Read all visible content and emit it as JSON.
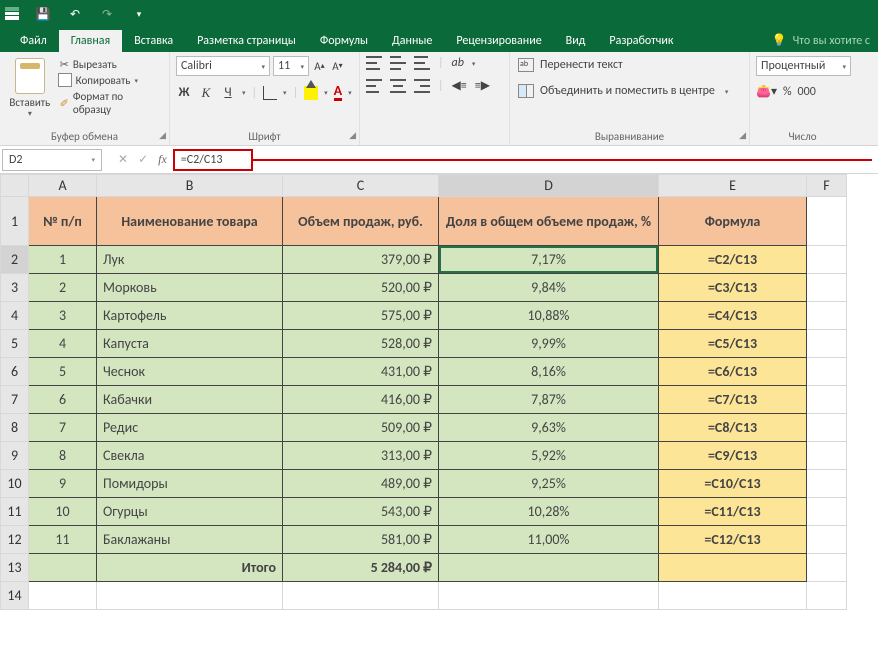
{
  "qat": {
    "save": "💾",
    "undo": "↶",
    "redo": "↷"
  },
  "menu": {
    "file": "Файл",
    "home": "Главная",
    "insert": "Вставка",
    "layout": "Разметка страницы",
    "formulas": "Формулы",
    "data": "Данные",
    "review": "Рецензирование",
    "view": "Вид",
    "developer": "Разработчик",
    "tell": "Что вы хотите с"
  },
  "ribbon": {
    "paste": "Вставить",
    "cut": "Вырезать",
    "copy": "Копировать",
    "painter": "Формат по образцу",
    "clipboard": "Буфер обмена",
    "font_name": "Calibri",
    "font_size": "11",
    "font_group": "Шрифт",
    "wrap": "Перенести текст",
    "merge": "Объединить и поместить в центре",
    "alignment": "Выравнивание",
    "number_format": "Процентный",
    "perc": "%",
    "thous": "000",
    "number_group": "Число"
  },
  "formula_bar": {
    "cell_ref": "D2",
    "formula": "=C2/C13"
  },
  "columns": [
    "A",
    "B",
    "C",
    "D",
    "E",
    "F"
  ],
  "headers": {
    "a": "№ п/п",
    "b": "Наименование товара",
    "c": "Объем продаж, руб.",
    "d": "Доля в общем объеме продаж, %",
    "e": "Формула"
  },
  "rows": [
    {
      "n": "1",
      "name": "Лук",
      "vol": "379,00 ₽",
      "share": "7,17%",
      "f": "=C2/C13"
    },
    {
      "n": "2",
      "name": "Морковь",
      "vol": "520,00 ₽",
      "share": "9,84%",
      "f": "=C3/C13"
    },
    {
      "n": "3",
      "name": "Картофель",
      "vol": "575,00 ₽",
      "share": "10,88%",
      "f": "=C4/C13"
    },
    {
      "n": "4",
      "name": "Капуста",
      "vol": "528,00 ₽",
      "share": "9,99%",
      "f": "=C5/C13"
    },
    {
      "n": "5",
      "name": "Чеснок",
      "vol": "431,00 ₽",
      "share": "8,16%",
      "f": "=C6/C13"
    },
    {
      "n": "6",
      "name": "Кабачки",
      "vol": "416,00 ₽",
      "share": "7,87%",
      "f": "=C7/C13"
    },
    {
      "n": "7",
      "name": "Редис",
      "vol": "509,00 ₽",
      "share": "9,63%",
      "f": "=C8/C13"
    },
    {
      "n": "8",
      "name": "Свекла",
      "vol": "313,00 ₽",
      "share": "5,92%",
      "f": "=C9/C13"
    },
    {
      "n": "9",
      "name": "Помидоры",
      "vol": "489,00 ₽",
      "share": "9,25%",
      "f": "=C10/C13"
    },
    {
      "n": "10",
      "name": "Огурцы",
      "vol": "543,00 ₽",
      "share": "10,28%",
      "f": "=C11/C13"
    },
    {
      "n": "11",
      "name": "Баклажаны",
      "vol": "581,00 ₽",
      "share": "11,00%",
      "f": "=C12/C13"
    }
  ],
  "total": {
    "label": "Итого",
    "value": "5 284,00 ₽"
  },
  "chart_data": {
    "type": "table",
    "title": "Доля в общем объеме продаж",
    "columns": [
      "№ п/п",
      "Наименование товара",
      "Объем продаж, руб.",
      "Доля в общем объеме продаж, %",
      "Формула"
    ],
    "rows": [
      [
        1,
        "Лук",
        379.0,
        0.0717,
        "=C2/C13"
      ],
      [
        2,
        "Морковь",
        520.0,
        0.0984,
        "=C3/C13"
      ],
      [
        3,
        "Картофель",
        575.0,
        0.1088,
        "=C4/C13"
      ],
      [
        4,
        "Капуста",
        528.0,
        0.0999,
        "=C5/C13"
      ],
      [
        5,
        "Чеснок",
        431.0,
        0.0816,
        "=C6/C13"
      ],
      [
        6,
        "Кабачки",
        416.0,
        0.0787,
        "=C7/C13"
      ],
      [
        7,
        "Редис",
        509.0,
        0.0963,
        "=C8/C13"
      ],
      [
        8,
        "Свекла",
        313.0,
        0.0592,
        "=C9/C13"
      ],
      [
        9,
        "Помидоры",
        489.0,
        0.0925,
        "=C10/C13"
      ],
      [
        10,
        "Огурцы",
        543.0,
        0.1028,
        "=C11/C13"
      ],
      [
        11,
        "Баклажаны",
        581.0,
        0.11,
        "=C12/C13"
      ]
    ],
    "total": 5284.0
  }
}
